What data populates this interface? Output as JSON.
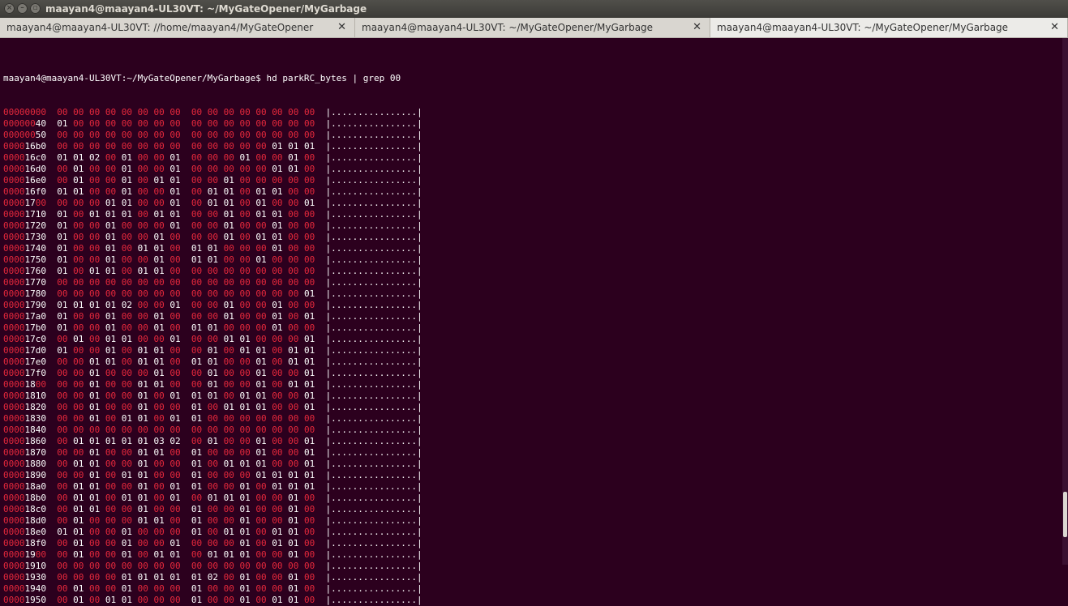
{
  "window": {
    "title": "maayan4@maayan4-UL30VT: ~/MyGateOpener/MyGarbage"
  },
  "tabs": [
    {
      "label": "maayan4@maayan4-UL30VT: //home/maayan4/MyGateOpener",
      "close": "✕"
    },
    {
      "label": "maayan4@maayan4-UL30VT: ~/MyGateOpener/MyGarbage",
      "close": "✕"
    },
    {
      "label": "maayan4@maayan4-UL30VT: ~/MyGateOpener/MyGarbage",
      "close": "✕",
      "active": true
    }
  ],
  "terminal": {
    "prompt": "maayan4@maayan4-UL30VT:~/MyGateOpener/MyGarbage$",
    "command": " hd parkRC_bytes | grep 00",
    "ascii": "|................|",
    "highlight_color": "#e6283c",
    "lines": [
      {
        "offset": "00000000",
        "hex": "00 00 00 00 00 00 00 00  00 00 00 00 00 00 00 00"
      },
      {
        "offset": "00000040",
        "hex": "01 00 00 00 00 00 00 00  00 00 00 00 00 00 00 00"
      },
      {
        "offset": "00000050",
        "hex": "00 00 00 00 00 00 00 00  00 00 00 00 00 00 00 00"
      },
      {
        "offset": "000016b0",
        "hex": "00 00 00 00 00 00 00 00  00 00 00 00 00 01 01 01"
      },
      {
        "offset": "000016c0",
        "hex": "01 01 02 00 01 00 00 01  00 00 00 01 00 00 01 00"
      },
      {
        "offset": "000016d0",
        "hex": "00 01 00 00 01 00 00 01  00 00 00 00 00 01 01 00"
      },
      {
        "offset": "000016e0",
        "hex": "00 01 00 00 01 00 01 01  00 00 01 00 00 00 00 00"
      },
      {
        "offset": "000016f0",
        "hex": "01 01 00 00 01 00 00 01  00 01 01 00 01 01 00 00"
      },
      {
        "offset": "00001700",
        "hex": "00 00 00 01 01 00 00 01  00 01 01 00 01 00 00 01"
      },
      {
        "offset": "00001710",
        "hex": "01 00 01 01 01 00 01 01  00 00 01 00 01 01 00 00"
      },
      {
        "offset": "00001720",
        "hex": "01 00 00 01 00 00 00 01  00 00 01 00 00 01 00 00"
      },
      {
        "offset": "00001730",
        "hex": "01 00 00 01 00 00 01 00  00 00 01 00 01 01 00 00"
      },
      {
        "offset": "00001740",
        "hex": "01 00 00 01 00 01 01 00  01 01 00 00 00 01 00 00"
      },
      {
        "offset": "00001750",
        "hex": "01 00 00 01 00 00 01 00  01 01 00 00 01 00 00 00"
      },
      {
        "offset": "00001760",
        "hex": "01 00 01 01 00 01 01 00  00 00 00 00 00 00 00 00"
      },
      {
        "offset": "00001770",
        "hex": "00 00 00 00 00 00 00 00  00 00 00 00 00 00 00 00"
      },
      {
        "offset": "00001780",
        "hex": "00 00 00 00 00 00 00 00  00 00 00 00 00 00 00 01"
      },
      {
        "offset": "00001790",
        "hex": "01 01 01 01 02 00 00 01  00 00 01 00 00 01 00 00"
      },
      {
        "offset": "000017a0",
        "hex": "01 00 00 01 00 00 01 00  00 00 01 00 00 01 00 01"
      },
      {
        "offset": "000017b0",
        "hex": "01 00 00 01 00 00 01 00  01 01 00 00 00 01 00 00"
      },
      {
        "offset": "000017c0",
        "hex": "00 01 00 01 01 00 00 01  00 00 01 01 00 00 00 01"
      },
      {
        "offset": "000017d0",
        "hex": "01 00 00 01 00 01 01 00  00 01 00 01 01 00 01 01"
      },
      {
        "offset": "000017e0",
        "hex": "00 00 01 01 00 01 01 00  01 01 00 00 01 00 01 01"
      },
      {
        "offset": "000017f0",
        "hex": "00 00 01 00 00 00 01 00  00 01 00 00 01 00 00 01"
      },
      {
        "offset": "00001800",
        "hex": "00 00 01 00 00 01 01 00  00 01 00 00 01 00 01 01"
      },
      {
        "offset": "00001810",
        "hex": "00 00 01 00 00 01 00 01  01 01 00 01 01 00 00 01"
      },
      {
        "offset": "00001820",
        "hex": "00 00 01 00 00 01 00 00  01 00 01 01 01 00 00 01"
      },
      {
        "offset": "00001830",
        "hex": "00 00 01 00 01 01 00 01  01 00 00 00 00 00 00 00"
      },
      {
        "offset": "00001840",
        "hex": "00 00 00 00 00 00 00 00  00 00 00 00 00 00 00 00"
      },
      {
        "offset": "00001860",
        "hex": "00 01 01 01 01 01 03 02  00 01 00 00 01 00 00 01"
      },
      {
        "offset": "00001870",
        "hex": "00 00 01 00 00 01 01 00  01 00 00 00 01 00 00 01"
      },
      {
        "offset": "00001880",
        "hex": "00 01 01 00 00 01 00 00  01 00 01 01 01 00 00 01"
      },
      {
        "offset": "00001890",
        "hex": "00 00 01 00 01 01 00 00  01 00 00 00 01 01 01 01"
      },
      {
        "offset": "000018a0",
        "hex": "00 01 01 00 00 01 00 01  01 00 00 01 00 01 01 01"
      },
      {
        "offset": "000018b0",
        "hex": "00 01 01 00 01 01 00 01  00 01 01 01 00 00 01 00"
      },
      {
        "offset": "000018c0",
        "hex": "00 01 01 00 00 01 00 00  01 00 00 01 00 00 01 00"
      },
      {
        "offset": "000018d0",
        "hex": "00 01 00 00 00 01 01 00  01 00 00 01 00 00 01 00"
      },
      {
        "offset": "000018e0",
        "hex": "01 01 00 00 01 00 00 00  01 00 01 01 00 01 01 00"
      },
      {
        "offset": "000018f0",
        "hex": "00 01 00 00 01 00 00 01  00 00 00 01 00 01 01 00"
      },
      {
        "offset": "00001900",
        "hex": "00 01 00 00 01 00 01 01  00 01 01 01 00 00 01 00"
      },
      {
        "offset": "00001910",
        "hex": "00 00 00 00 00 00 00 00  00 00 00 00 00 00 00 00"
      },
      {
        "offset": "00001930",
        "hex": "00 00 00 00 01 01 01 01  01 02 00 01 00 00 01 00"
      },
      {
        "offset": "00001940",
        "hex": "00 01 00 00 01 00 00 00  01 00 00 01 00 00 01 00"
      },
      {
        "offset": "00001950",
        "hex": "00 01 00 01 01 00 00 00  01 00 00 01 00 01 01 00"
      }
    ]
  }
}
